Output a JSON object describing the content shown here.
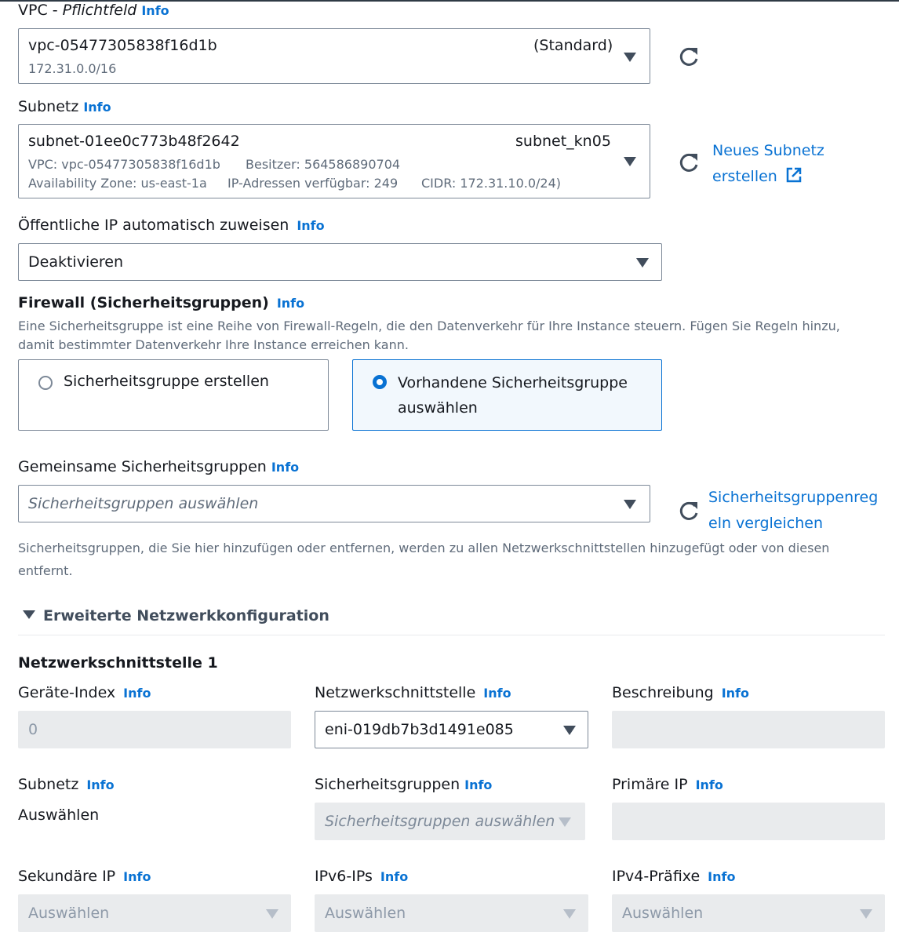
{
  "vpc": {
    "label": "VPC - ",
    "label_italic": "Pflichtfeld",
    "info": "Info",
    "value": "vpc-05477305838f16d1b",
    "tag": "(Standard)",
    "cidr": "172.31.0.0/16"
  },
  "subnet": {
    "label": "Subnetz",
    "info": "Info",
    "value": "subnet-01ee0c773b48f2642",
    "name": "subnet_kn05",
    "vpc_line": "VPC: vpc-05477305838f16d1b",
    "owner": "Besitzer: 564586890704",
    "az": "Availability Zone: us-east-1a",
    "ips": "IP-Adressen verfügbar: 249",
    "cidr": "CIDR: 172.31.10.0/24)",
    "new_link_line1": "Neues Subnetz",
    "new_link_line2": "erstellen"
  },
  "public_ip": {
    "label": "Öffentliche IP automatisch zuweisen",
    "info": "Info",
    "value": "Deaktivieren"
  },
  "firewall": {
    "title": "Firewall (Sicherheitsgruppen)",
    "info": "Info",
    "description_line1": "Eine Sicherheitsgruppe ist eine Reihe von Firewall-Regeln, die den Datenverkehr für Ihre Instance steuern. Fügen Sie Regeln hinzu,",
    "description_line2": "damit bestimmter Datenverkehr Ihre Instance erreichen kann.",
    "option_create": "Sicherheitsgruppe erstellen",
    "option_existing_line1": "Vorhandene Sicherheitsgruppe",
    "option_existing_line2": "auswählen",
    "selected": "existing"
  },
  "shared_sg": {
    "label": "Gemeinsame Sicherheitsgruppen",
    "info": "Info",
    "placeholder": "Sicherheitsgruppen auswählen",
    "compare_line1": "Sicherheitsgruppenreg",
    "compare_line2": "eln vergleichen",
    "hint_line1": "Sicherheitsgruppen, die Sie hier hinzufügen oder entfernen, werden zu allen Netzwerkschnittstellen hinzugefügt oder von diesen",
    "hint_line2": "entfernt."
  },
  "advanced": {
    "title": "Erweiterte Netzwerkkonfiguration",
    "interface_title": "Netzwerkschnittstelle 1",
    "device_index": {
      "label": "Geräte-Index",
      "info": "Info",
      "value": "0"
    },
    "network_interface": {
      "label": "Netzwerkschnittstelle",
      "info": "Info",
      "value": "eni-019db7b3d1491e085"
    },
    "description": {
      "label": "Beschreibung",
      "info": "Info",
      "value": ""
    },
    "subnet": {
      "label": "Subnetz",
      "info": "Info",
      "value": "Auswählen"
    },
    "security_groups": {
      "label": "Sicherheitsgruppen",
      "info": "Info",
      "placeholder": "Sicherheitsgruppen auswählen"
    },
    "primary_ip": {
      "label": "Primäre IP",
      "info": "Info",
      "value": ""
    },
    "secondary_ip": {
      "label": "Sekundäre IP",
      "info": "Info",
      "value": "Auswählen"
    },
    "ipv6": {
      "label": "IPv6-IPs",
      "info": "Info",
      "value": "Auswählen"
    },
    "ipv4_prefix": {
      "label": "IPv4-Präfixe",
      "info": "Info",
      "value": "Auswählen"
    }
  },
  "colors": {
    "link": "#0972d3",
    "selected_bg": "#f2f8fd",
    "border": "#7d8998",
    "disabled_bg": "#e9ebed"
  }
}
